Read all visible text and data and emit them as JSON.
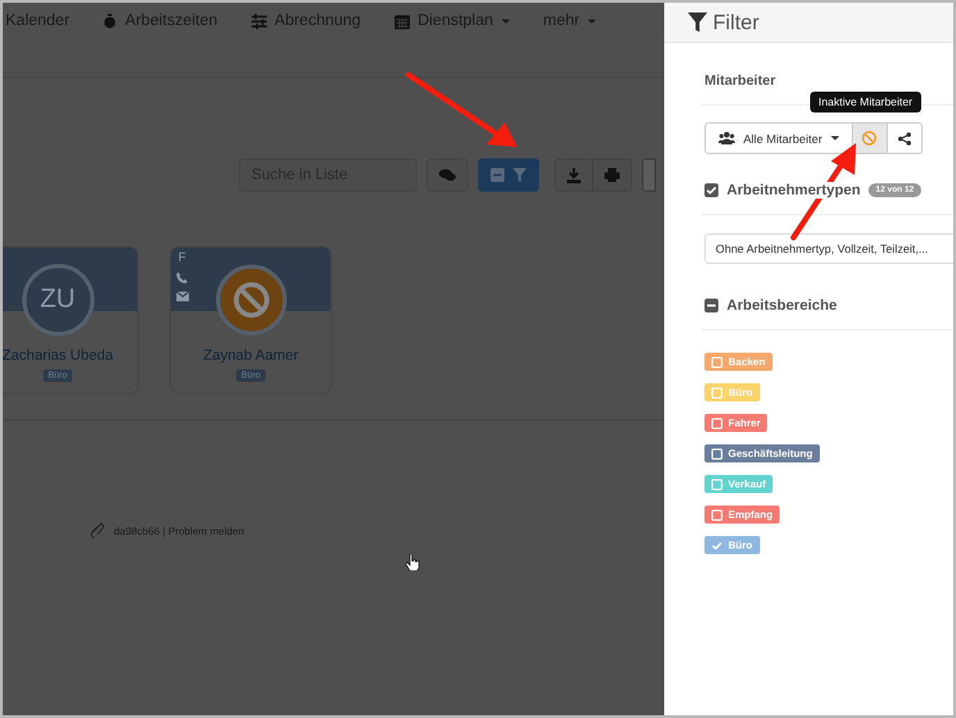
{
  "nav": [
    {
      "label": "Kalender",
      "dropdown": false
    },
    {
      "label": "Arbeitszeiten",
      "dropdown": false
    },
    {
      "label": "Abrechnung",
      "dropdown": false
    },
    {
      "label": "Dienstplan",
      "dropdown": true
    },
    {
      "label": "mehr",
      "dropdown": true
    }
  ],
  "toolbar": {
    "search": {
      "placeholder": "Suche in Liste"
    },
    "filter_active": true
  },
  "cards": [
    {
      "initials": "ZU",
      "name": "Zacharias Ubeda",
      "tag": "Büro",
      "inactive": false
    },
    {
      "name": "Zaynab Aamer",
      "tag": "Büro",
      "inactive": true,
      "contact": [
        "F"
      ]
    }
  ],
  "footer": "da98cb66 | Problem melden",
  "filter": {
    "title": "Filter",
    "employees": {
      "heading": "Mitarbeiter",
      "dropdown": "Alle Mitarbeiter",
      "inactive_selected": true,
      "tooltip": "Inaktive Mitarbeiter"
    },
    "types": {
      "heading": "Arbeitnehmertypen",
      "checked": true,
      "badge": "12 von 12",
      "value": "Ohne Arbeitnehmertyp, Vollzeit, Teilzeit,..."
    },
    "areas": {
      "heading": "Arbeitsbereiche",
      "indeterminate": true,
      "tags": [
        {
          "label": "Backen",
          "color": "#f6a76c",
          "checked": false
        },
        {
          "label": "Büro",
          "color": "#fcd26a",
          "checked": false
        },
        {
          "label": "Fahrer",
          "color": "#f47a72",
          "checked": false
        },
        {
          "label": "Geschäftsleitung",
          "color": "#6a7d9c",
          "checked": false
        },
        {
          "label": "Verkauf",
          "color": "#63d3cf",
          "checked": false
        },
        {
          "label": "Empfang",
          "color": "#f47a72",
          "checked": false
        },
        {
          "label": "Büro",
          "color": "#8fb8e0",
          "checked": true
        }
      ]
    }
  }
}
